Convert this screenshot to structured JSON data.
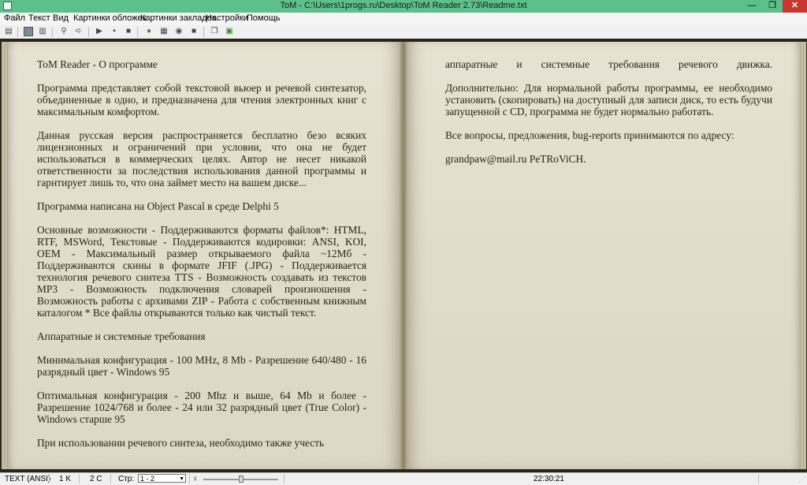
{
  "window": {
    "title": "ToM - C:\\Users\\1progs.ru\\Desktop\\ToM Reader 2.73\\Readme.txt",
    "min_glyph": "—",
    "max_glyph": "❐",
    "close_glyph": "✕"
  },
  "menu": {
    "items": [
      "Файл",
      "Текст",
      "Вид",
      "Картинки обложек",
      "Картинки закладок",
      "Настройки",
      "Помощь"
    ]
  },
  "toolbar": {
    "icons": [
      "open-icon",
      "book-icon",
      "document-icon",
      "find-icon",
      "find-next-icon",
      "play-icon",
      "pause-icon",
      "stop-icon",
      "speech-icon",
      "bookmark-icon",
      "voice-icon",
      "record-icon",
      "window-icon",
      "export-icon"
    ]
  },
  "book": {
    "left_paragraphs": [
      "ToM Reader - О программе",
      " Программа представляет собой текстовой вьюер и речевой синтезатор, объединенные в одно, и предназначена для чтения электронных книг с максимальным комфортом.",
      " Данная русская версия распространяется бесплатно безо всяких лицензионных и ограничений при условии, что она не будет использоваться в коммерческих целях. Автор не несет никакой ответственности за последствия использования данной программы и гарнтирует лишь то, что она займет место на вашем диске...",
      " Программа написана на Object Pascal в среде Delphi 5",
      " Основные возможности - Поддерживаются форматы файлов*: HTML, RTF, MSWord, Текстовые - Поддерживаются кодировки: ANSI, KOI, OEM - Максимальный размер открываемого файла ~12Мб - Поддерживаются скины в формате JFIF (.JPG) - Поддерживается технология речевого синтеза TTS - Возможность создавать из текстов MP3 - Возможность подключения словарей произношения - Возможность работы с архивами ZIP - Работа с собственным книжным каталогом * Все файлы открываются только как чистый текст.",
      " Аппаратные и системные требования",
      " Минимальная конфигурация - 100 MHz, 8 Mb - Разрешение 640/480 - 16 разрядный цвет - Windows 95",
      " Оптимальная конфигурация - 200 Mhz и выше, 64 Mb и более - Разрешение 1024/768 и более - 24 или 32 разрядный цвет (True Color) - Windows старше 95",
      " При использовании речевого синтеза, необходимо также учесть"
    ],
    "right_paragraphs": [
      "аппаратные и системные требования речевого движка.",
      " Дополнительно: Для нормальной работы программы, ее необходимо установить (скопировать) на доступный для записи диск, то есть будучи запущенной с CD, программа не будет нормально работать.",
      " Все вопросы, предложения, bug-reports принимаются по адресу:",
      " grandpaw@mail.ru PeTRoViCH."
    ]
  },
  "statusbar": {
    "encoding": "TEXT (ANSI)",
    "size": "1 K",
    "chars": "2 C",
    "page_label": "Стр:",
    "page_value": "1 - 2",
    "volume_fraction": 0.5,
    "time": "22:30:21"
  },
  "colors": {
    "titlebar": "#5bc08a",
    "page": "#e3decd",
    "text": "#2b2418",
    "background": "#2c2418"
  }
}
